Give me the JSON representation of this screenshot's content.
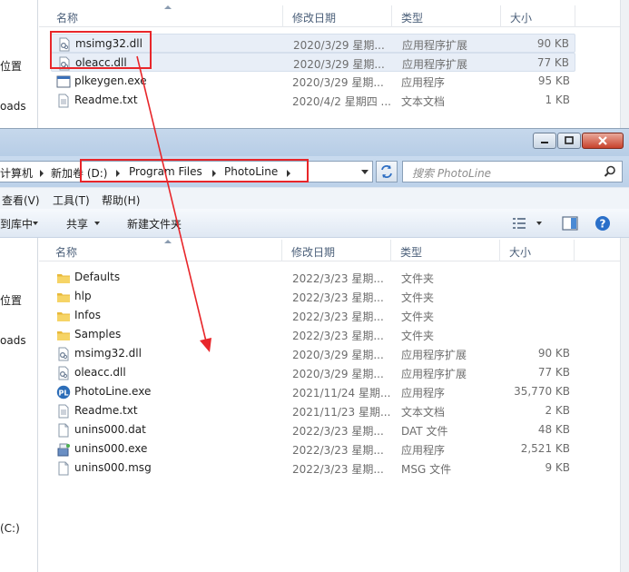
{
  "columns": {
    "name": "名称",
    "date": "修改日期",
    "type": "类型",
    "size": "大小"
  },
  "top_window": {
    "left_items": [
      "位置",
      "oads"
    ],
    "files": [
      {
        "name": "msimg32.dll",
        "date": "2020/3/29 星期...",
        "type": "应用程序扩展",
        "size": "90 KB",
        "icon": "dll-icon"
      },
      {
        "name": "oleacc.dll",
        "date": "2020/3/29 星期...",
        "type": "应用程序扩展",
        "size": "77 KB",
        "icon": "dll-icon"
      },
      {
        "name": "plkeygen.exe",
        "date": "2020/3/29 星期...",
        "type": "应用程序",
        "size": "95 KB",
        "icon": "exe-window-icon"
      },
      {
        "name": "Readme.txt",
        "date": "2020/4/2 星期四 ...",
        "type": "文本文档",
        "size": "1 KB",
        "icon": "text-file-icon"
      }
    ]
  },
  "bottom_window": {
    "address": {
      "crumbs": [
        "计算机",
        "新加卷 (D:)",
        "Program Files",
        "PhotoLine"
      ]
    },
    "search_placeholder": "搜索 PhotoLine",
    "menu": [
      "查看(V)",
      "工具(T)",
      "帮助(H)"
    ],
    "commands": [
      "到库中",
      "共享",
      "新建文件夹"
    ],
    "left_items": [
      "位置",
      "oads",
      "(C:)"
    ],
    "files": [
      {
        "name": "Defaults",
        "date": "2022/3/23 星期...",
        "type": "文件夹",
        "size": "",
        "icon": "folder-icon"
      },
      {
        "name": "hlp",
        "date": "2022/3/23 星期...",
        "type": "文件夹",
        "size": "",
        "icon": "folder-icon"
      },
      {
        "name": "Infos",
        "date": "2022/3/23 星期...",
        "type": "文件夹",
        "size": "",
        "icon": "folder-icon"
      },
      {
        "name": "Samples",
        "date": "2022/3/23 星期...",
        "type": "文件夹",
        "size": "",
        "icon": "folder-icon"
      },
      {
        "name": "msimg32.dll",
        "date": "2020/3/29 星期...",
        "type": "应用程序扩展",
        "size": "90 KB",
        "icon": "dll-icon"
      },
      {
        "name": "oleacc.dll",
        "date": "2020/3/29 星期...",
        "type": "应用程序扩展",
        "size": "77 KB",
        "icon": "dll-icon"
      },
      {
        "name": "PhotoLine.exe",
        "date": "2021/11/24 星期...",
        "type": "应用程序",
        "size": "35,770 KB",
        "icon": "photoline-app-icon"
      },
      {
        "name": "Readme.txt",
        "date": "2021/11/23 星期...",
        "type": "文本文档",
        "size": "2 KB",
        "icon": "text-file-icon"
      },
      {
        "name": "unins000.dat",
        "date": "2022/3/23 星期...",
        "type": "DAT 文件",
        "size": "48 KB",
        "icon": "blank-file-icon"
      },
      {
        "name": "unins000.exe",
        "date": "2022/3/23 星期...",
        "type": "应用程序",
        "size": "2,521 KB",
        "icon": "installer-icon"
      },
      {
        "name": "unins000.msg",
        "date": "2022/3/23 星期...",
        "type": "MSG 文件",
        "size": "9 KB",
        "icon": "blank-file-icon"
      }
    ]
  },
  "annotation_color": "#e8262a"
}
